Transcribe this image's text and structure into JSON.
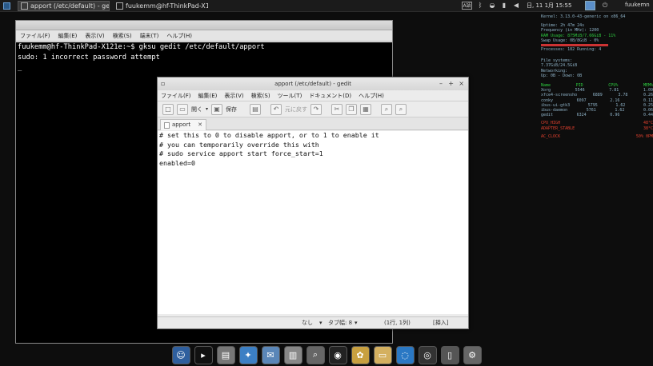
{
  "panel": {
    "tasks": [
      "apport (/etc/default) - gedit",
      "fuukemm@hf-ThinkPad-X1..."
    ],
    "clock": "日, 11 1月 15:55",
    "user": "fuukemn"
  },
  "terminal": {
    "menu": [
      "ファイル(F)",
      "編集(E)",
      "表示(V)",
      "検索(S)",
      "端末(T)",
      "ヘルプ(H)"
    ],
    "lines": [
      "fuukemm@hf-ThinkPad-X121e:~$ gksu gedit /etc/default/apport",
      "sudo: 1 incorrect password attempt",
      "_"
    ]
  },
  "gedit": {
    "title": "apport (/etc/default) - gedit",
    "menu": [
      "ファイル(F)",
      "編集(E)",
      "表示(V)",
      "検索(S)",
      "ツール(T)",
      "ドキュメント(D)",
      "ヘルプ(H)"
    ],
    "toolbar": {
      "open": "開く",
      "save": "保存",
      "undo": "元に戻す"
    },
    "tab_label": "apport",
    "text_lines": [
      "# set this to 0 to disable apport, or to 1 to enable it",
      "# you can temporarily override this with",
      "# sudo service apport start force_start=1",
      "enabled=0"
    ],
    "status": {
      "syntax": "なし",
      "tab_width": "タブ幅: 8",
      "position": "(1行, 1列)",
      "mode": "[挿入]"
    }
  },
  "conky": {
    "kernel": "Kernel: 3.13.0-43-generic on x86_64",
    "uptime": "Uptime: 2h 47m 24s",
    "frequency": "Frequency (in MHz): 1200",
    "ram": "RAM Usage: 875MiB/7.66GiB - 11%",
    "swap": "Swap Usage: 0B/8GiB - 0%",
    "processes": "Processes: 182  Running: 4",
    "file_systems": "File systems:",
    "fs_usage": "7.37GiB/24.5GiB",
    "networking": "Networking:",
    "net": "Up: 0B    - Down: 0B",
    "table_headers": [
      "Name",
      "PID",
      "CPU%",
      "MEM%"
    ],
    "processes_list": [
      [
        "Xorg",
        "5546",
        "7.81",
        "1.09"
      ],
      [
        "xfce4-screensho",
        "6889",
        "3.78",
        "0.26"
      ],
      [
        "conky",
        "6097",
        "2.16",
        "0.11"
      ],
      [
        "ibus-ui-gtk3",
        "5795",
        "1.62",
        "0.25"
      ],
      [
        "ibus-daemon",
        "5761",
        "1.62",
        "0.06"
      ],
      [
        "gedit",
        "6324",
        "0.96",
        "0.44"
      ]
    ],
    "temps": [
      [
        "CPU_HIGH",
        "48°C"
      ],
      [
        "ADAPTER_STABLE",
        "38°C"
      ]
    ],
    "battery": [
      "AC_CLOCK",
      "50% 0PM"
    ]
  },
  "dock": {
    "icons": [
      "finder-icon",
      "terminal-icon",
      "files-icon",
      "safari-icon",
      "mail-icon",
      "apps-icon",
      "preview-icon",
      "photo-icon",
      "games-icon",
      "folder-icon",
      "web-icon",
      "disk-icon",
      "trash-icon",
      "settings-icon"
    ]
  }
}
